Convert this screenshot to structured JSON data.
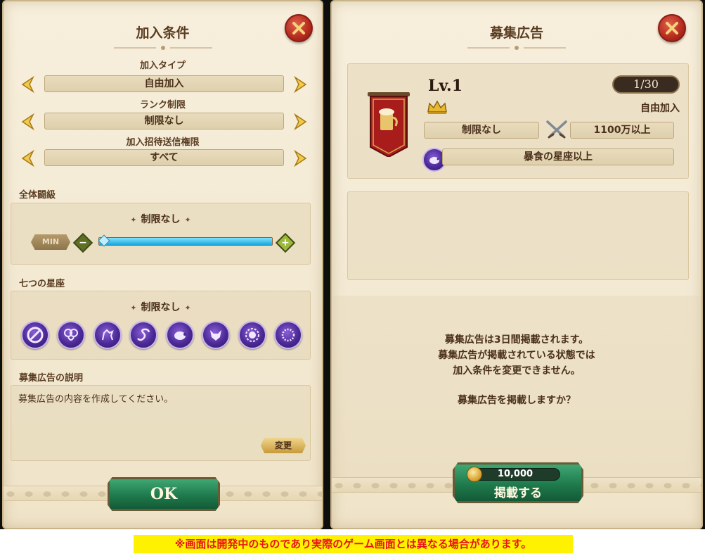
{
  "left": {
    "title": "加入条件",
    "join_type": {
      "label": "加入タイプ",
      "value": "自由加入"
    },
    "rank_limit": {
      "label": "ランク制限",
      "value": "制限なし"
    },
    "invite_permission": {
      "label": "加入招待送信権限",
      "value": "すべて"
    },
    "overall_rank": {
      "label": "全体闘級",
      "value": "制限なし",
      "min_label": "MIN",
      "slider_level": 1.0
    },
    "constellation": {
      "label": "七つの星座",
      "value": "制限なし",
      "icons": [
        "none-icon",
        "ram-icon",
        "goat-icon",
        "serpent-icon",
        "boar-icon",
        "fox-icon",
        "lion-icon",
        "wreath-icon"
      ]
    },
    "description": {
      "label": "募集広告の説明",
      "text": "募集広告の内容を作成してください。",
      "change_label": "変更"
    },
    "ok_label": "OK"
  },
  "right": {
    "title": "募集広告",
    "level": "Lv.1",
    "members": "1/30",
    "join_type": "自由加入",
    "rank_limit": "制限なし",
    "power": "1100万以上",
    "constellation": "暴食の星座以上",
    "notice_lines": [
      "募集広告は3日間掲載されます。",
      "募集広告が掲載されている状態では",
      "加入条件を変更できません。",
      "",
      "募集広告を掲載しますか？"
    ],
    "cost": "10,000",
    "post_label": "掲載する"
  },
  "disclaimer": "※画面は開発中のものであり実際のゲーム画面とは異なる場合があります。",
  "colors": {
    "parchment": "#f3e9d3",
    "text_brown": "#4a2f1a",
    "close_red": "#b42a1e",
    "button_green": "#1f7a4c",
    "zodiac_purple": "#4c2a96",
    "slider_blue": "#1aa6de",
    "disclaimer_bg": "#fff200",
    "disclaimer_text": "#e8131b"
  }
}
